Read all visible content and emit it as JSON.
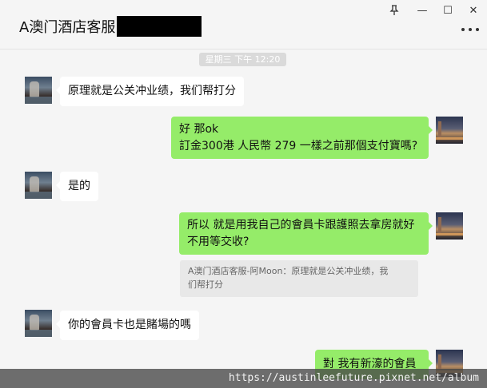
{
  "window": {
    "title": "A澳门酒店客服",
    "controls": {
      "pin_icon": "pin-icon",
      "minimize_glyph": "—",
      "maximize_glyph": "☐",
      "close_glyph": "✕"
    }
  },
  "chat": {
    "time_label": "星期三 下午 12:20",
    "messages": [
      {
        "side": "in",
        "text": "原理就是公关冲业绩，我们帮打分"
      },
      {
        "side": "out",
        "lines": [
          "好  那ok",
          "訂金300港  人民幣 279  一樣之前那個支付寶嗎?"
        ]
      },
      {
        "side": "in",
        "text": "是的"
      },
      {
        "side": "out",
        "lines": [
          "所以  就是用我自己的會員卡跟護照去拿房就好",
          "不用等交收?"
        ]
      },
      {
        "side": "quote",
        "lines": [
          "A澳门酒店客服-阿Moon：原理就是公关冲业绩，我",
          "们帮打分"
        ]
      },
      {
        "side": "in",
        "text": "你的會員卡也是賭場的嗎"
      },
      {
        "side": "out",
        "text": "對  我有新濠的會員"
      }
    ]
  },
  "watermark": "https://austinleefuture.pixnet.net/album",
  "colors": {
    "outgoing_bubble": "#95ec69",
    "incoming_bubble": "#ffffff",
    "background": "#f5f5f5"
  }
}
